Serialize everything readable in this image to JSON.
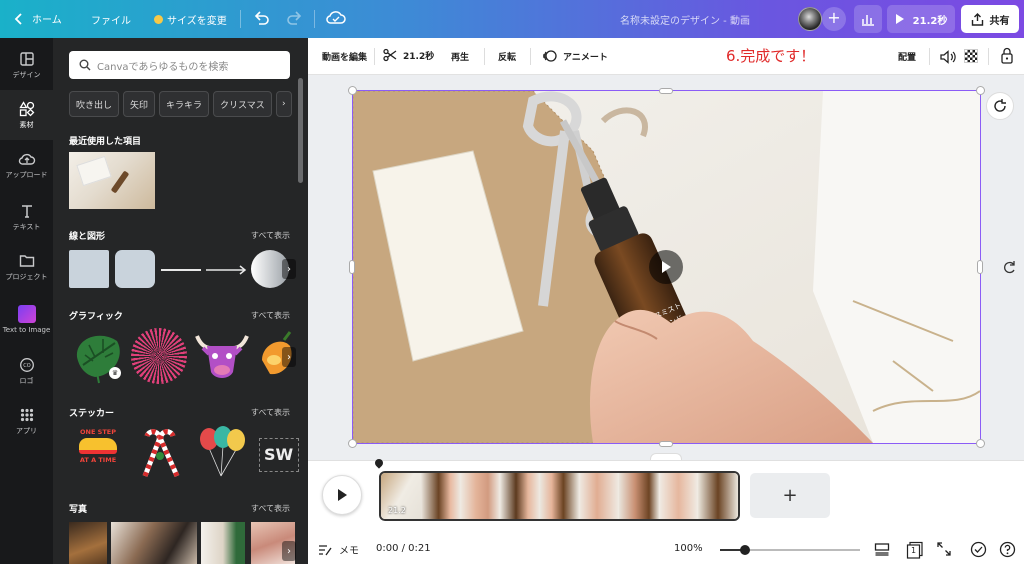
{
  "topbar": {
    "home_label": "ホーム",
    "file_label": "ファイル",
    "resize_label": "サイズを変更",
    "doc_title": "名称未設定のデザイン - 動画",
    "play_label": "21.2秒",
    "share_label": "共有"
  },
  "rail": {
    "items": [
      {
        "label": "デザイン",
        "icon": "layout-icon"
      },
      {
        "label": "素材",
        "icon": "elements-icon"
      },
      {
        "label": "アップロード",
        "icon": "upload-icon"
      },
      {
        "label": "テキスト",
        "icon": "text-icon"
      },
      {
        "label": "プロジェクト",
        "icon": "folder-icon"
      },
      {
        "label": "Text to Image",
        "icon": "text-to-image-icon"
      },
      {
        "label": "ロゴ",
        "icon": "logo-icon"
      },
      {
        "label": "アプリ",
        "icon": "apps-icon"
      }
    ]
  },
  "panel": {
    "search_placeholder": "Canvaであらゆるものを検索",
    "chips": [
      "吹き出し",
      "矢印",
      "キラキラ",
      "クリスマス"
    ],
    "recent_title": "最近使用した項目",
    "shapes_title": "線と図形",
    "graphics_title": "グラフィック",
    "stickers_title": "ステッカー",
    "photos_title": "写真",
    "see_all": "すべて表示",
    "sticker_text_line1": "ONE STEP",
    "sticker_text_line2": "AT A TIME",
    "sticker_sw": "SW"
  },
  "toolbar": {
    "edit_video": "動画を編集",
    "duration": "21.2秒",
    "playback": "再生",
    "flip": "反転",
    "animate": "アニメート",
    "position": "配置"
  },
  "annotation": "6.完成です！",
  "canvas": {
    "bottle_label_line1": "フレグランスミスト",
    "bottle_label_line2": "おやすみブレンド"
  },
  "timeline": {
    "clip_duration": "21.2",
    "add_page": "+"
  },
  "bottombar": {
    "notes_label": "メモ",
    "time_display": "0:00 / 0:21",
    "zoom_label": "100%",
    "zoom_fraction": 0.18,
    "page_count": "1"
  },
  "colors": {
    "accent": "#8b5cf6",
    "annotation": "#e02a2a",
    "panel_bg": "#252627",
    "rail_bg": "#18191b"
  }
}
